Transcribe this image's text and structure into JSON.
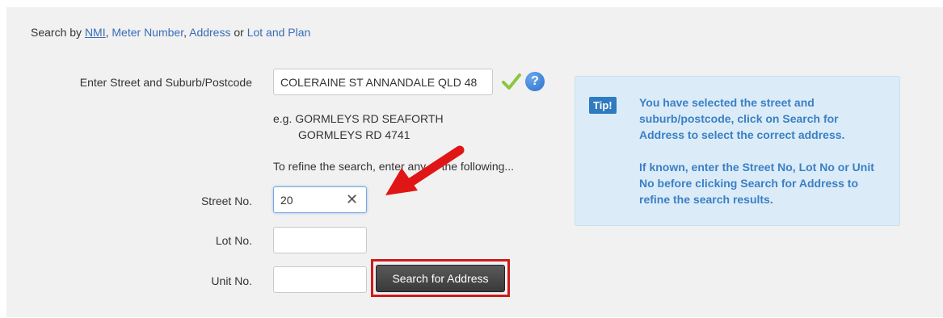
{
  "search_by": {
    "prefix": "Search by",
    "nmi": "NMI",
    "sep1": ",",
    "meter": "Meter Number",
    "sep2": ",",
    "address": "Address",
    "or": "or",
    "lot_plan": "Lot and Plan"
  },
  "street_field": {
    "label": "Enter Street and Suburb/Postcode",
    "value": "COLERAINE ST ANNANDALE QLD 48"
  },
  "example": {
    "line1": "e.g. GORMLEYS RD SEAFORTH",
    "line2": "GORMLEYS RD 4741"
  },
  "refine_text": "To refine the search, enter any of the following...",
  "street_no": {
    "label": "Street No.",
    "value": "20"
  },
  "lot_no": {
    "label": "Lot No.",
    "value": ""
  },
  "unit_no": {
    "label": "Unit No.",
    "value": ""
  },
  "search_button": "Search for Address",
  "tip": {
    "badge": "Tip!",
    "para1": "You have selected the street and suburb/postcode, click on Search for Address to select the correct address.",
    "para2": "If known, enter the Street No, Lot No or Unit No before clicking Search for Address to refine the search results."
  },
  "colors": {
    "accent": "#3a6cb8",
    "highlight": "#d11a1a",
    "tip_bg": "#dbecf8"
  }
}
